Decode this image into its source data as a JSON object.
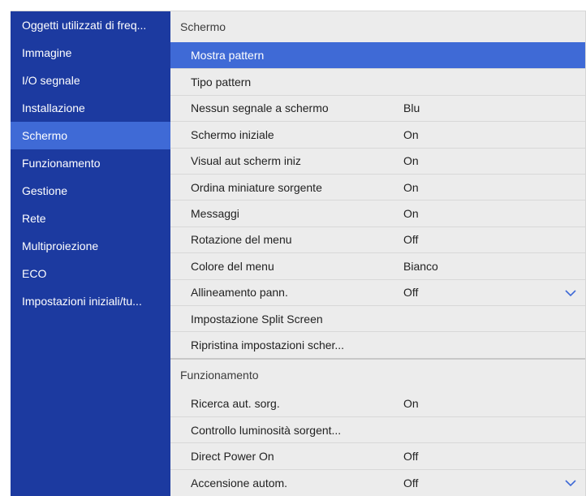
{
  "sidebar": {
    "items": [
      {
        "label": "Oggetti utilizzati di freq..."
      },
      {
        "label": "Immagine"
      },
      {
        "label": "I/O segnale"
      },
      {
        "label": "Installazione"
      },
      {
        "label": "Schermo"
      },
      {
        "label": "Funzionamento"
      },
      {
        "label": "Gestione"
      },
      {
        "label": "Rete"
      },
      {
        "label": "Multiproiezione"
      },
      {
        "label": "ECO"
      },
      {
        "label": "Impostazioni iniziali/tu..."
      }
    ],
    "active_index": 4
  },
  "main": {
    "sections": [
      {
        "title": "Schermo",
        "rows": [
          {
            "label": "Mostra pattern",
            "value": ""
          },
          {
            "label": "Tipo pattern",
            "value": ""
          },
          {
            "label": "Nessun segnale a schermo",
            "value": "Blu"
          },
          {
            "label": "Schermo iniziale",
            "value": "On"
          },
          {
            "label": "Visual aut scherm iniz",
            "value": "On"
          },
          {
            "label": "Ordina miniature sorgente",
            "value": "On"
          },
          {
            "label": "Messaggi",
            "value": "On"
          },
          {
            "label": "Rotazione del menu",
            "value": "Off"
          },
          {
            "label": "Colore del menu",
            "value": "Bianco"
          },
          {
            "label": "Allineamento pann.",
            "value": "Off"
          },
          {
            "label": "Impostazione Split Screen",
            "value": ""
          },
          {
            "label": "Ripristina impostazioni scher...",
            "value": ""
          }
        ]
      },
      {
        "title": "Funzionamento",
        "rows": [
          {
            "label": "Ricerca aut. sorg.",
            "value": "On"
          },
          {
            "label": "Controllo luminosità sorgent...",
            "value": ""
          },
          {
            "label": "Direct Power On",
            "value": "Off"
          },
          {
            "label": "Accensione autom.",
            "value": "Off"
          }
        ]
      }
    ]
  },
  "colors": {
    "sidebar_bg": "#1c3aa0",
    "accent": "#3f6ad6",
    "panel_bg": "#ececec"
  }
}
